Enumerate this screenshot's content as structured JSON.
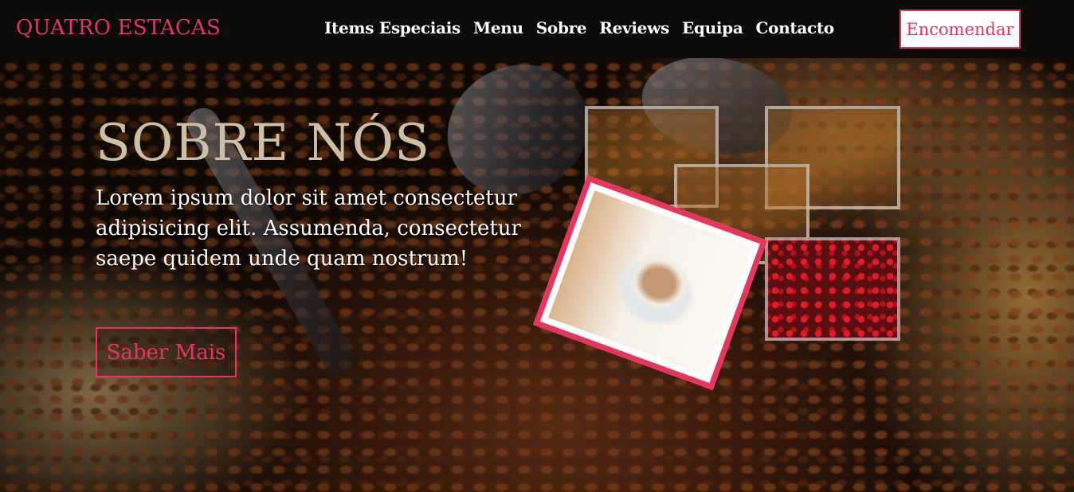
{
  "header": {
    "brand": "QUATRO ESTACAS",
    "nav": [
      "Items Especiais",
      "Menu",
      "Sobre",
      "Reviews",
      "Equipa",
      "Contacto"
    ],
    "order_label": "Encomendar"
  },
  "hero": {
    "title": "SOBRE NÓS",
    "lead": "Lorem ipsum dolor sit amet consectetur adipisicing elit. Assumenda, consectetur saepe quidem unde quam nostrum!",
    "cta_label": "Saber Mais"
  },
  "colors": {
    "accent": "#e8355e",
    "header_bg": "#0d0b09",
    "title": "#cdbfa6"
  }
}
